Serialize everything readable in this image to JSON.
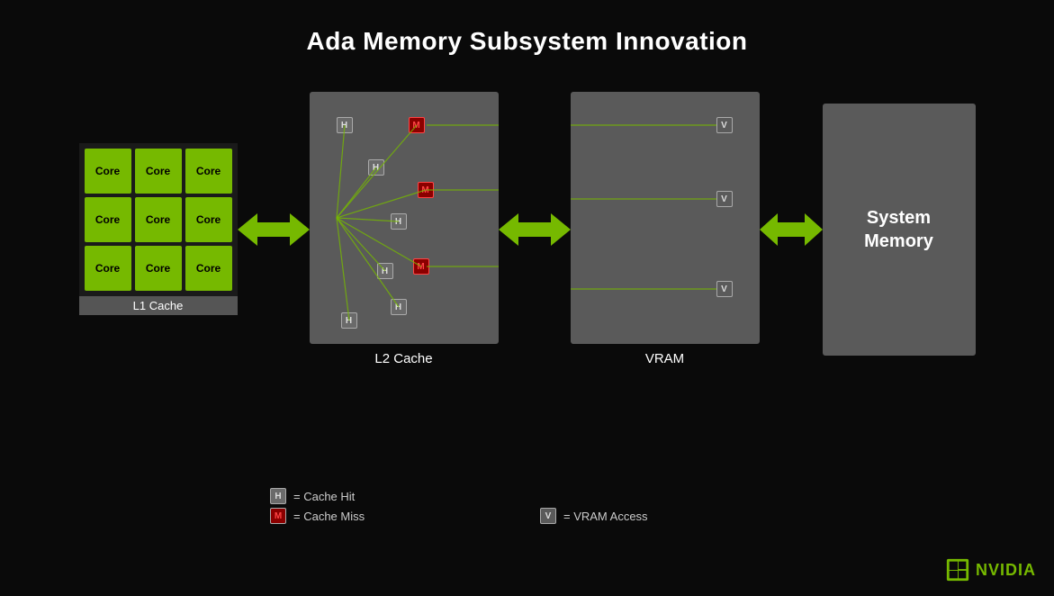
{
  "page": {
    "title": "Ada Memory Subsystem Innovation",
    "background": "#0a0a0a"
  },
  "cores": {
    "label": "Core",
    "grid": [
      "Core",
      "Core",
      "Core",
      "Core",
      "Core",
      "Core",
      "Core",
      "Core",
      "Core"
    ],
    "l1_label": "L1 Cache"
  },
  "panels": {
    "l2": {
      "label": "L2 Cache"
    },
    "vram": {
      "label": "VRAM"
    },
    "sys": {
      "line1": "System",
      "line2": "Memory"
    }
  },
  "legend": {
    "h_label": "H",
    "h_text": "= Cache Hit",
    "m_label": "M",
    "m_text": "= Cache Miss",
    "v_label": "V",
    "v_text": "= VRAM Access"
  },
  "nvidia": {
    "text": "NVIDIA"
  }
}
